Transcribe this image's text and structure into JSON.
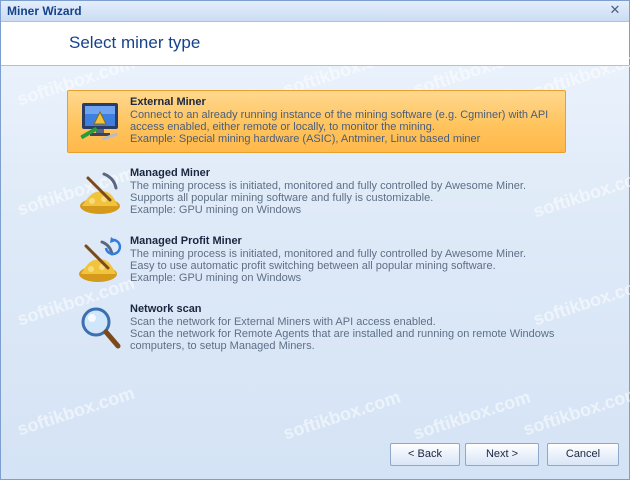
{
  "window": {
    "title": "Miner Wizard",
    "close_glyph": "✕"
  },
  "header": {
    "title": "Select miner type"
  },
  "options": [
    {
      "title": "External Miner",
      "icon": "monitor-tools-icon",
      "lines": [
        "Connect to an already running instance of the mining software (e.g. Cgminer) with API",
        "access enabled, either remote or locally, to monitor the mining.",
        "Example: Special mining hardware (ASIC), Antminer, Linux based miner"
      ],
      "selected": true
    },
    {
      "title": "Managed Miner",
      "icon": "gold-pickaxe-icon",
      "lines": [
        "The mining process is initiated, monitored and fully controlled by Awesome Miner.",
        "Supports all popular mining software and fully is customizable.",
        "Example: GPU mining on Windows"
      ],
      "selected": false
    },
    {
      "title": "Managed Profit Miner",
      "icon": "gold-pickaxe-refresh-icon",
      "lines": [
        "The mining process is initiated, monitored and fully controlled by Awesome Miner.",
        "Easy to use automatic profit switching between all popular mining software.",
        "Example: GPU mining on Windows"
      ],
      "selected": false
    },
    {
      "title": "Network scan",
      "icon": "magnifier-icon",
      "lines": [
        "Scan the network for External Miners with API access enabled.",
        "Scan the network for Remote Agents that are installed and running on remote Windows",
        "computers, to setup Managed Miners."
      ],
      "selected": false
    }
  ],
  "buttons": {
    "back": "< Back",
    "next": "Next >",
    "cancel": "Cancel"
  },
  "watermark": "softikbox.com"
}
